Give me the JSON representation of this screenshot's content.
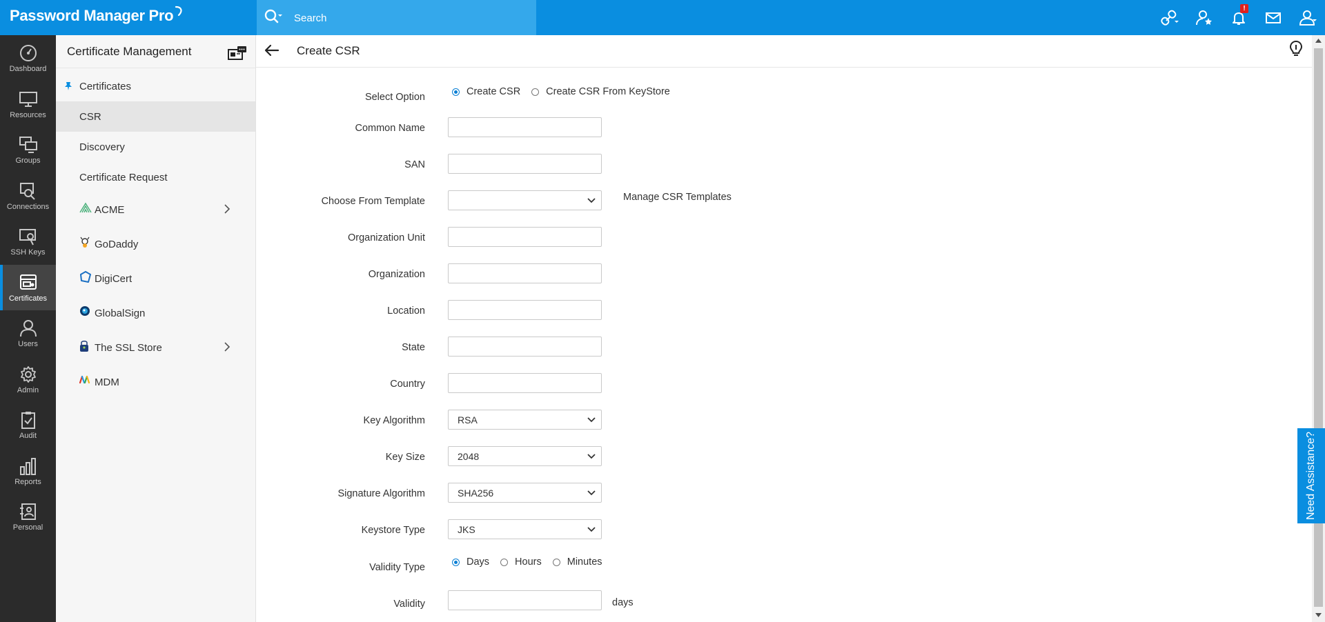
{
  "app": {
    "title": "Password Manager Pro"
  },
  "search": {
    "placeholder": "Search"
  },
  "topbar": {
    "icons": [
      "connections-link-icon",
      "favorites-star-icon",
      "notifications-bell-icon",
      "mail-icon",
      "user-profile-icon"
    ],
    "notification_badge": "!"
  },
  "leftnav": {
    "items": [
      {
        "label": "Dashboard",
        "icon": "dashboard-icon"
      },
      {
        "label": "Resources",
        "icon": "monitor-icon"
      },
      {
        "label": "Groups",
        "icon": "groups-icon"
      },
      {
        "label": "Connections",
        "icon": "connections-icon"
      },
      {
        "label": "SSH Keys",
        "icon": "ssh-key-icon"
      },
      {
        "label": "Certificates",
        "icon": "certificate-icon",
        "active": true
      },
      {
        "label": "Users",
        "icon": "user-icon"
      },
      {
        "label": "Admin",
        "icon": "gear-icon"
      },
      {
        "label": "Audit",
        "icon": "clipboard-check-icon"
      },
      {
        "label": "Reports",
        "icon": "bar-chart-icon"
      },
      {
        "label": "Personal",
        "icon": "contact-book-icon"
      }
    ]
  },
  "subnav": {
    "title": "Certificate Management",
    "items": [
      {
        "label": "Certificates"
      },
      {
        "label": "CSR",
        "active": true
      },
      {
        "label": "Discovery"
      },
      {
        "label": "Certificate Request"
      },
      {
        "label": "ACME",
        "icon": "acme-icon",
        "has_submenu": true
      },
      {
        "label": "GoDaddy",
        "icon": "godaddy-icon"
      },
      {
        "label": "DigiCert",
        "icon": "digicert-icon"
      },
      {
        "label": "GlobalSign",
        "icon": "globalsign-icon"
      },
      {
        "label": "The SSL Store",
        "icon": "ssl-store-icon",
        "has_submenu": true
      },
      {
        "label": "MDM",
        "icon": "mdm-icon"
      }
    ]
  },
  "page": {
    "title": "Create CSR"
  },
  "form": {
    "select_option": {
      "label": "Select Option",
      "options": [
        "Create CSR",
        "Create CSR From KeyStore"
      ],
      "selected": "Create CSR"
    },
    "common_name": {
      "label": "Common Name",
      "value": ""
    },
    "san": {
      "label": "SAN",
      "value": ""
    },
    "template": {
      "label": "Choose From Template",
      "value": "",
      "link": "Manage CSR Templates"
    },
    "org_unit": {
      "label": "Organization Unit",
      "value": ""
    },
    "organization": {
      "label": "Organization",
      "value": ""
    },
    "location": {
      "label": "Location",
      "value": ""
    },
    "state": {
      "label": "State",
      "value": ""
    },
    "country": {
      "label": "Country",
      "value": ""
    },
    "key_algorithm": {
      "label": "Key Algorithm",
      "value": "RSA"
    },
    "key_size": {
      "label": "Key Size",
      "value": "2048"
    },
    "signature_algorithm": {
      "label": "Signature Algorithm",
      "value": "SHA256"
    },
    "keystore_type": {
      "label": "Keystore Type",
      "value": "JKS"
    },
    "validity_type": {
      "label": "Validity Type",
      "options": [
        "Days",
        "Hours",
        "Minutes"
      ],
      "selected": "Days"
    },
    "validity": {
      "label": "Validity",
      "value": "",
      "unit": "days"
    }
  },
  "assist": {
    "label": "Need Assistance?"
  },
  "colors": {
    "brand": "#0a8ee0",
    "nav_bg": "#2b2b2b",
    "sidebar_bg": "#f6f6f6"
  }
}
